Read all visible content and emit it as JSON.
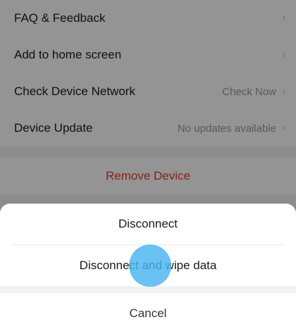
{
  "settings": {
    "items": [
      {
        "label": "FAQ & Feedback",
        "value": ""
      },
      {
        "label": "Add to home screen",
        "value": ""
      },
      {
        "label": "Check Device Network",
        "value": "Check Now"
      },
      {
        "label": "Device Update",
        "value": "No updates available"
      }
    ],
    "remove_label": "Remove Device",
    "chevron": "›"
  },
  "sheet": {
    "options": [
      "Disconnect",
      "Disconnect and wipe data"
    ],
    "cancel_label": "Cancel"
  },
  "colors": {
    "danger": "#e53935",
    "touch_indicator": "#48b4f0",
    "overlay": "rgba(0,0,0,0.42)"
  },
  "icons": {
    "chevron": "chevron-right-icon"
  }
}
